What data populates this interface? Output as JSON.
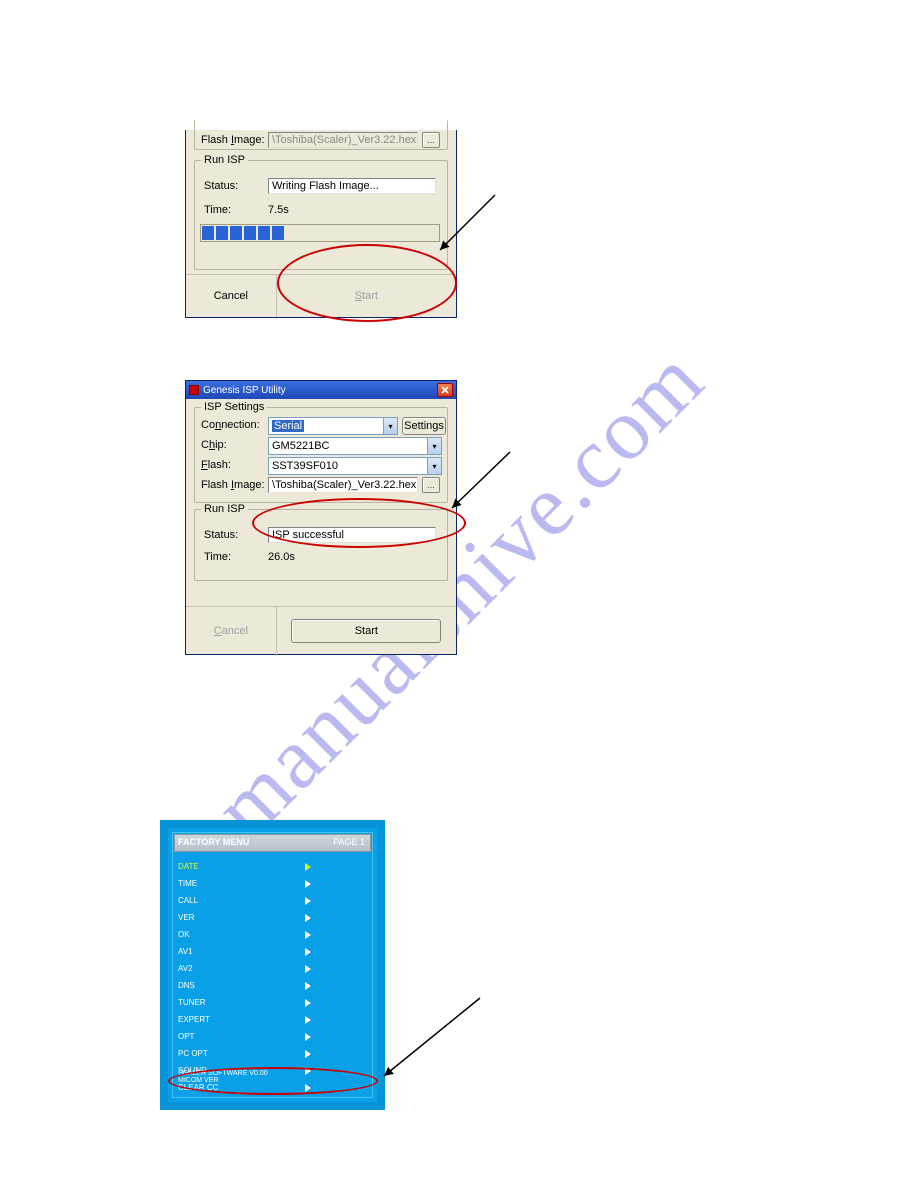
{
  "watermark": "manualshive.com",
  "panel1": {
    "flash_image_label": "Flash Image:",
    "flash_image_label_u": "I",
    "flash_image_value": "\\Toshiba(Scaler)_Ver3.22.hex",
    "browse_label": "...",
    "runisp_legend": "Run ISP",
    "status_label": "Status:",
    "status_value": "Writing Flash Image...",
    "time_label": "Time:",
    "time_value": "7.5s",
    "progress_segments": 6,
    "cancel_label": "Cancel",
    "cancel_u": "C",
    "start_label": "Start",
    "start_u": "S"
  },
  "panel2": {
    "title": "Genesis ISP Utility",
    "isp_settings_legend": "ISP Settings",
    "connection_label": "Connection:",
    "connection_u": "n",
    "connection_value": "Serial",
    "settings_label": "Settings",
    "settings_u": "e",
    "chip_label": "Chip:",
    "chip_u": "h",
    "chip_value": "GM5221BC",
    "flash_label": "Flash:",
    "flash_u": "F",
    "flash_value": "SST39SF010",
    "flash_image_label": "Flash Image:",
    "flash_image_u": "I",
    "flash_image_value": "\\Toshiba(Scaler)_Ver3.22.hex",
    "browse_label": "...",
    "runisp_legend": "Run ISP",
    "status_label": "Status:",
    "status_value": "ISP successful",
    "time_label": "Time:",
    "time_value": "26.0s",
    "cancel_label": "Cancel",
    "cancel_u": "C",
    "start_label": "Start",
    "start_u": "S"
  },
  "osd": {
    "title": "FACTORY MENU",
    "page": "PAGE 1",
    "rows": [
      {
        "label": "DATE",
        "value": "",
        "sel": true
      },
      {
        "label": "TIME",
        "value": ""
      },
      {
        "label": "CALL",
        "value": ""
      },
      {
        "label": "VER",
        "value": ""
      },
      {
        "label": "OK",
        "value": ""
      },
      {
        "label": "AV1",
        "value": ""
      },
      {
        "label": "AV2",
        "value": ""
      },
      {
        "label": "DNS",
        "value": ""
      },
      {
        "label": "TUNER",
        "value": ""
      },
      {
        "label": "EXPERT",
        "value": ""
      },
      {
        "label": "OPT",
        "value": ""
      },
      {
        "label": "PC OPT",
        "value": ""
      },
      {
        "label": "SOUND",
        "value": ""
      },
      {
        "label": "CLEAR CC",
        "value": ""
      }
    ],
    "footer1": "SCALER SOFTWARE V0.00",
    "footer2": "MICOM VER"
  }
}
